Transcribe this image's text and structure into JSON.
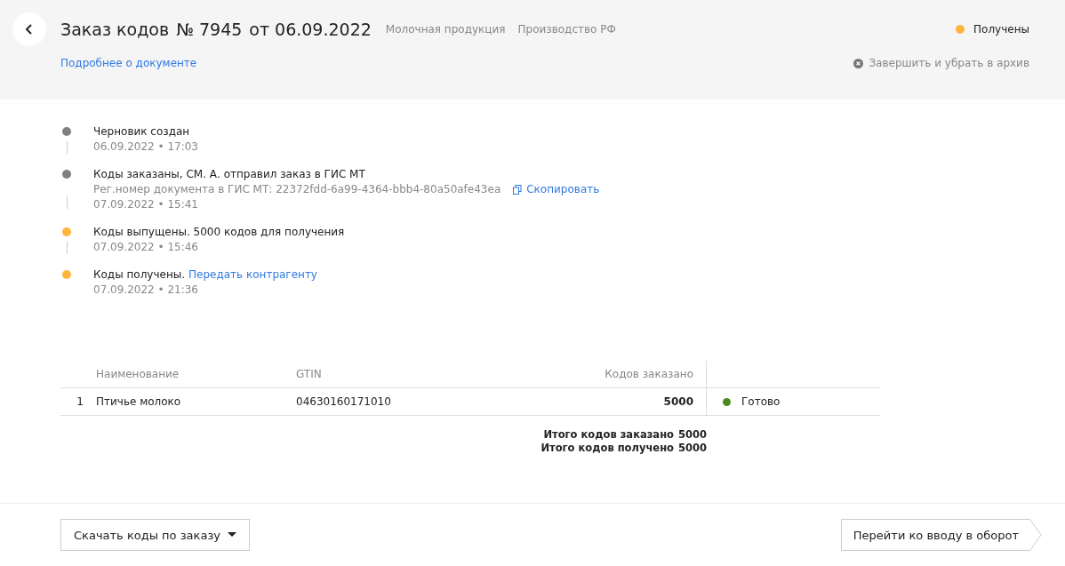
{
  "header": {
    "title": "Заказ кодов",
    "number": "№ 7945",
    "date": "от 06.09.2022",
    "tags": [
      "Молочная продукция",
      "Производство РФ"
    ],
    "status": {
      "label": "Получены",
      "color": "#ffb43c"
    },
    "details_link": "Подробнее о документе",
    "archive_action": "Завершить и убрать в архив"
  },
  "timeline": [
    {
      "title": "Черновик создан",
      "time": "06.09.2022 • 17:03",
      "color": "#808080"
    },
    {
      "title": "Коды заказаны, СМ. А. отправил заказ в ГИС МТ",
      "detail": "Рег.номер документа в ГИС МТ: 22372fdd-6a99-4364-bbb4-80a50afe43ea",
      "copy_link": "Скопировать",
      "time": "07.09.2022 • 15:41",
      "color": "#808080"
    },
    {
      "title": "Коды выпущены. 5000 кодов для получения",
      "time": "07.09.2022 • 15:46",
      "color": "#ffb43c"
    },
    {
      "title": "Коды получены.",
      "link": "Передать контрагенту",
      "time": "07.09.2022 • 21:36",
      "color": "#ffb43c"
    }
  ],
  "table": {
    "columns": [
      "Наименование",
      "GTIN",
      "Кодов заказано"
    ],
    "rows": [
      {
        "index": "1",
        "name": "Птичье молоко",
        "gtin": "04630160171010",
        "ordered": "5000",
        "status": "Готово",
        "color": "#4c8c1e"
      }
    ],
    "totals": [
      {
        "label": "Итого кодов заказано",
        "value": "5000"
      },
      {
        "label": "Итого кодов получено",
        "value": "5000"
      }
    ]
  },
  "footer": {
    "download_button": "Скачать коды по заказу",
    "next_button": "Перейти ко вводу в оборот"
  }
}
